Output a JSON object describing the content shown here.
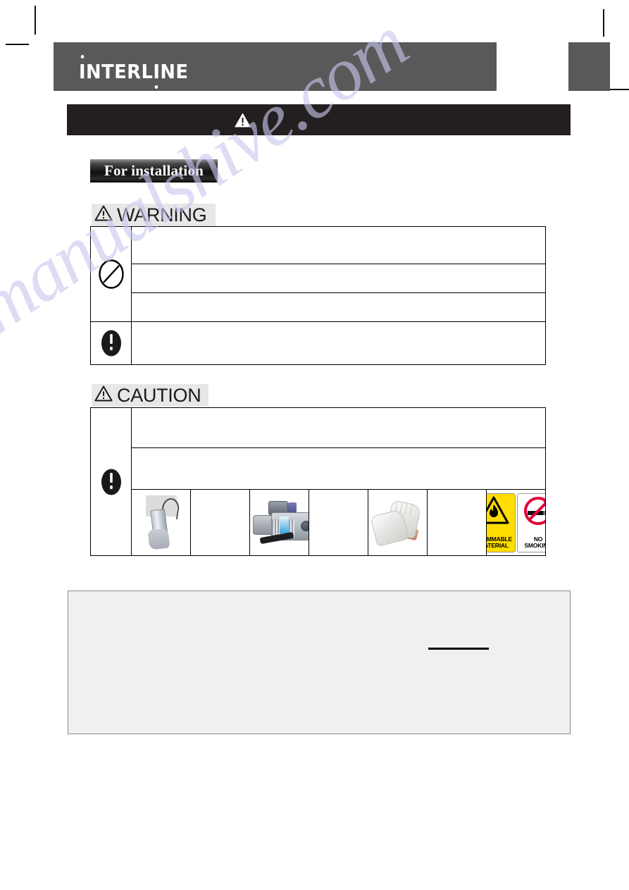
{
  "document": {
    "brand": "INTERLINE",
    "banner_icon": "warning-triangle-icon",
    "section_label": "For installation",
    "watermark": "manualshive.com"
  },
  "warning_block": {
    "signal_word": "WARNING",
    "signal_icon": "warning-triangle-icon",
    "rows": [
      {
        "symbol": "prohibition-icon",
        "symbol_rowspan": 3,
        "text": ""
      },
      {
        "symbol": "",
        "text": ""
      },
      {
        "symbol": "",
        "text": ""
      },
      {
        "symbol": "mandatory-icon",
        "symbol_rowspan": 1,
        "text": ""
      }
    ]
  },
  "caution_block": {
    "signal_word": "CAUTION",
    "signal_icon": "warning-triangle-icon",
    "rows": [
      {
        "symbol": "mandatory-icon",
        "symbol_rowspan": 3,
        "text": ""
      },
      {
        "symbol": "",
        "text": ""
      },
      {
        "symbol": "",
        "text": ""
      }
    ],
    "tool_row": [
      {
        "name": "leak-detector-image",
        "caption": ""
      },
      {
        "name": "blank-cell",
        "caption": ""
      },
      {
        "name": "vacuum-pump-image",
        "caption": ""
      },
      {
        "name": "blank-cell",
        "caption": ""
      },
      {
        "name": "work-gloves-image",
        "caption": ""
      },
      {
        "name": "blank-cell",
        "caption": ""
      },
      {
        "name": "safety-signs-image",
        "caption": ""
      }
    ]
  },
  "safety_signs": {
    "flammable": {
      "line1": "FLAMMABLE",
      "line2": "MATERIAL",
      "color": "#ffdd00"
    },
    "no_smoking": {
      "line1": "NO",
      "line2": "SMOKING",
      "color": "#ffffff",
      "accent": "#e4003a"
    }
  },
  "note_panel": {
    "text": "",
    "rule": ""
  },
  "colors": {
    "masthead": "#595959",
    "banner": "#231f20",
    "signal_pill": "#e7e7e7",
    "note_panel_fill": "#f0f0f0",
    "note_panel_border": "#8c8c8c",
    "table_border": "#000000"
  }
}
